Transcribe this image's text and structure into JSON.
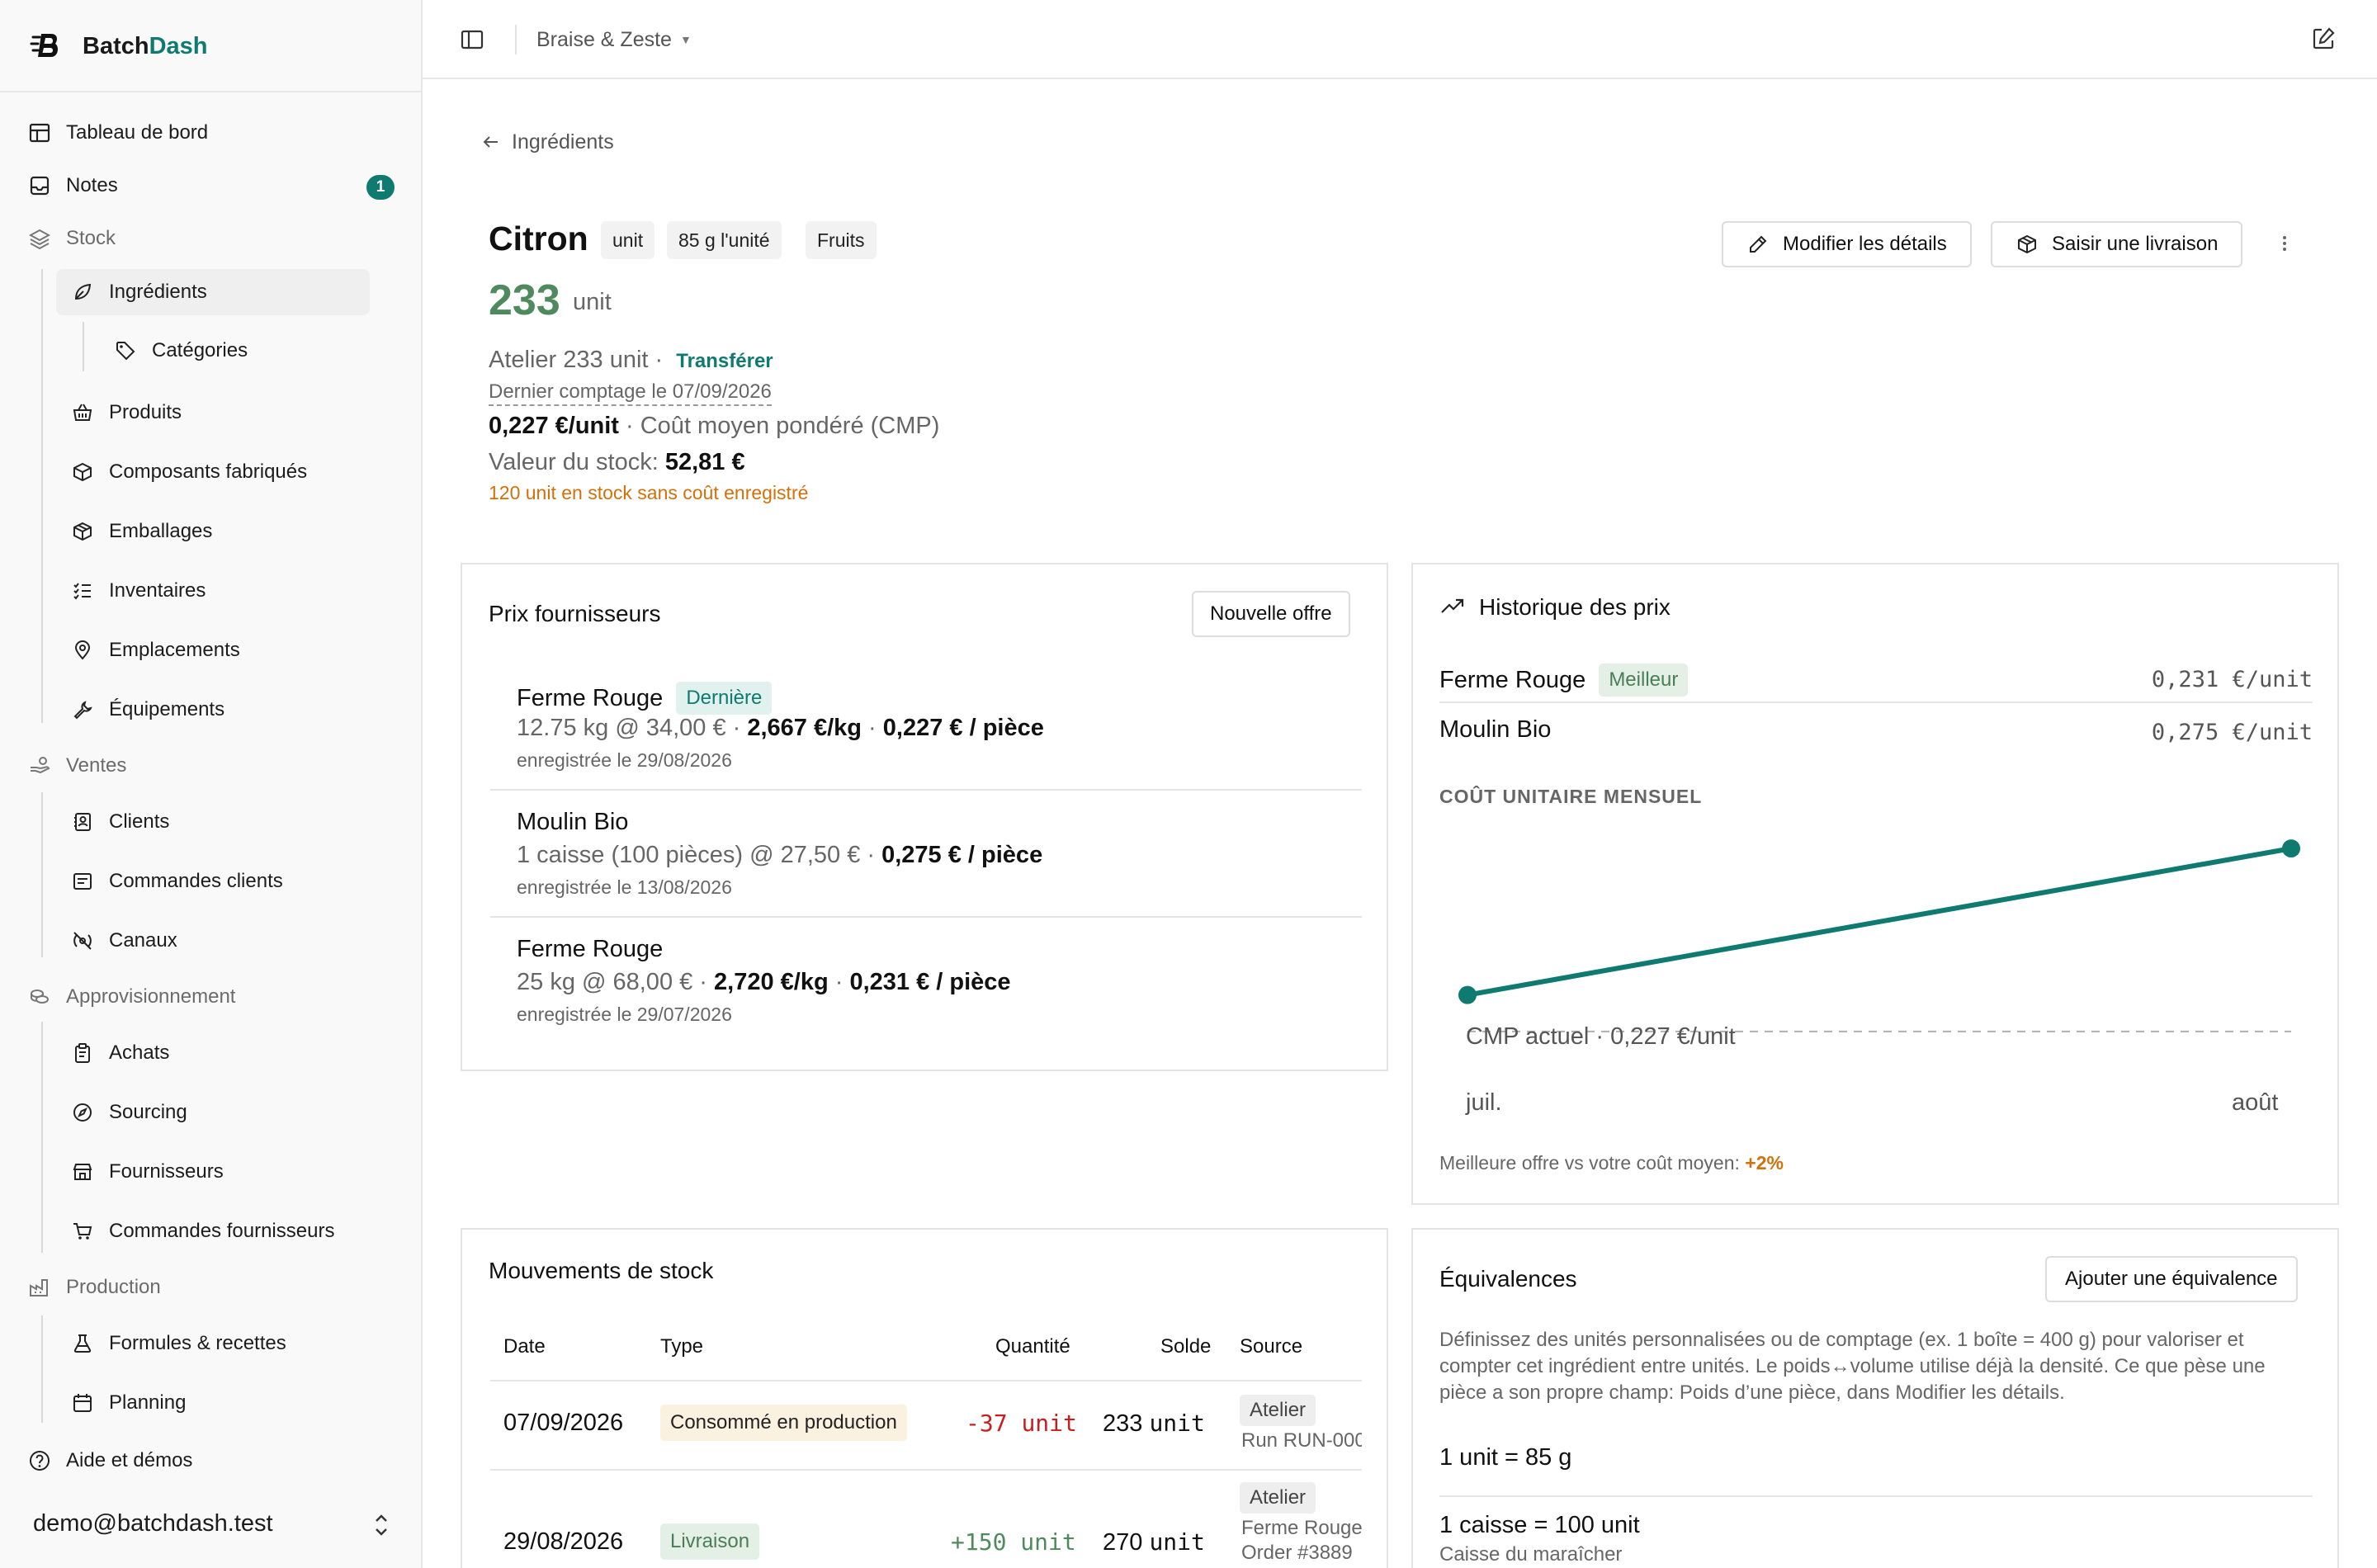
{
  "brand": {
    "prefix": "Batch",
    "accent": "Dash"
  },
  "sidebar": {
    "items": [
      {
        "label": "Tableau de bord",
        "icon": "layout-icon"
      },
      {
        "label": "Notes",
        "icon": "inbox-icon",
        "badge": "1"
      },
      {
        "label": "Stock",
        "icon": "layers-icon"
      },
      {
        "label": "Ingrédients",
        "icon": "leaf-icon"
      },
      {
        "label": "Catégories",
        "icon": "tag-icon"
      },
      {
        "label": "Produits",
        "icon": "basket-icon"
      },
      {
        "label": "Composants fabriqués",
        "icon": "cube-icon"
      },
      {
        "label": "Emballages",
        "icon": "package-icon"
      },
      {
        "label": "Inventaires",
        "icon": "checklist-icon"
      },
      {
        "label": "Emplacements",
        "icon": "map-pin-icon"
      },
      {
        "label": "Équipements",
        "icon": "wrench-icon"
      },
      {
        "label": "Ventes",
        "icon": "hand-coins-icon"
      },
      {
        "label": "Clients",
        "icon": "contact-icon"
      },
      {
        "label": "Commandes clients",
        "icon": "receipt-icon"
      },
      {
        "label": "Canaux",
        "icon": "radio-icon"
      },
      {
        "label": "Approvisionnement",
        "icon": "coins-icon"
      },
      {
        "label": "Achats",
        "icon": "clipboard-icon"
      },
      {
        "label": "Sourcing",
        "icon": "compass-icon"
      },
      {
        "label": "Fournisseurs",
        "icon": "store-icon"
      },
      {
        "label": "Commandes fournisseurs",
        "icon": "cart-icon"
      },
      {
        "label": "Production",
        "icon": "factory-icon"
      },
      {
        "label": "Formules & recettes",
        "icon": "flask-icon"
      },
      {
        "label": "Planning",
        "icon": "calendar-icon"
      },
      {
        "label": "Aide et démos",
        "icon": "help-icon"
      }
    ],
    "user_email": "demo@batchdash.test"
  },
  "topbar": {
    "workspace": "Braise & Zeste"
  },
  "page": {
    "back_label": "Ingrédients",
    "title": "Citron",
    "chips": [
      "unit",
      "85 g l'unité",
      "Fruits"
    ],
    "edit_button": "Modifier les détails",
    "delivery_button": "Saisir une livraison",
    "stock_qty": "233",
    "stock_unit": "unit",
    "location_text": "Atelier 233 unit ·",
    "transfer_link": "Transférer",
    "last_count": "Dernier comptage le 07/09/2026",
    "cmp_value": "0,227 €/unit",
    "cmp_label": " · Coût moyen pondéré (CMP)",
    "stock_value_label": "Valeur du stock: ",
    "stock_value": "52,81 €",
    "warning": "120 unit en stock sans coût enregistré"
  },
  "supplier_prices": {
    "title": "Prix fournisseurs",
    "new_offer_button": "Nouvelle offre",
    "offers": [
      {
        "supplier": "Ferme Rouge",
        "tag": "Dernière",
        "qty_text": "12.75 kg @ 34,00 € · ",
        "per_kg": "2,667 €/kg",
        "sep": " · ",
        "per_piece": "0,227 € / pièce",
        "date": "enregistrée le 29/08/2026"
      },
      {
        "supplier": "Moulin Bio",
        "tag": "",
        "qty_text": "1 caisse (100 pièces) @ 27,50 € · ",
        "per_kg": "",
        "sep": "",
        "per_piece": "0,275 € / pièce",
        "date": "enregistrée le 13/08/2026"
      },
      {
        "supplier": "Ferme Rouge",
        "tag": "",
        "qty_text": "25 kg @ 68,00 € · ",
        "per_kg": "2,720 €/kg",
        "sep": " · ",
        "per_piece": "0,231 € / pièce",
        "date": "enregistrée le 29/07/2026"
      }
    ]
  },
  "price_history": {
    "title": "Historique des prix",
    "rows": [
      {
        "supplier": "Ferme Rouge",
        "tag": "Meilleur",
        "value": "0,231 €/unit"
      },
      {
        "supplier": "Moulin Bio",
        "tag": "",
        "value": "0,275 €/unit"
      }
    ],
    "chart_label": "COÛT UNITAIRE MENSUEL",
    "cmp_reference": "CMP actuel · 0,227 €/unit",
    "footer_text": "Meilleure offre vs votre coût moyen: ",
    "footer_delta": "+2%"
  },
  "chart_data": {
    "type": "line",
    "title": "COÛT UNITAIRE MENSUEL",
    "categories": [
      "juil.",
      "août"
    ],
    "series": [
      {
        "values": [
          0.231,
          0.275
        ]
      }
    ],
    "reference_line": {
      "label": "CMP actuel · 0,227 €/unit",
      "value": 0.227
    },
    "ylim": [
      0.222,
      0.279
    ],
    "color": "#0e7a70",
    "grid": false
  },
  "movements": {
    "title": "Mouvements de stock",
    "headers": [
      "Date",
      "Type",
      "Quantité",
      "Solde",
      "Source"
    ],
    "rows": [
      {
        "date": "07/09/2026",
        "type": "Consommé en production",
        "qty_num": "-37",
        "qty_unit": "unit",
        "balance": "233",
        "balance_unit": "unit",
        "source": "Atelier",
        "source_detail": "Run RUN-000",
        "source_detail2": ""
      },
      {
        "date": "29/08/2026",
        "type": "Livraison",
        "qty_num": "+150",
        "qty_unit": "unit",
        "balance": "270",
        "balance_unit": "unit",
        "source": "Atelier",
        "source_detail": "Ferme Rouge",
        "source_detail2": "Order #3889"
      }
    ]
  },
  "equivalences": {
    "title": "Équivalences",
    "add_button": "Ajouter une équivalence",
    "description": "Définissez des unités personnalisées ou de comptage (ex. 1 boîte = 400 g) pour valoriser et compter cet ingrédient entre unités. Le poids↔volume utilise déjà la densité. Ce que pèse une pièce a son propre champ: Poids d’une pièce, dans Modifier les détails.",
    "items": [
      {
        "text": "1 unit = 85 g",
        "note": ""
      },
      {
        "text": "1 caisse = 100 unit",
        "note": "Caisse du maraîcher"
      }
    ]
  },
  "colors": {
    "accent": "#0e7a70",
    "stock_green": "#4f8a5e",
    "warning": "#d4700a",
    "negative": "#c81e1e"
  }
}
